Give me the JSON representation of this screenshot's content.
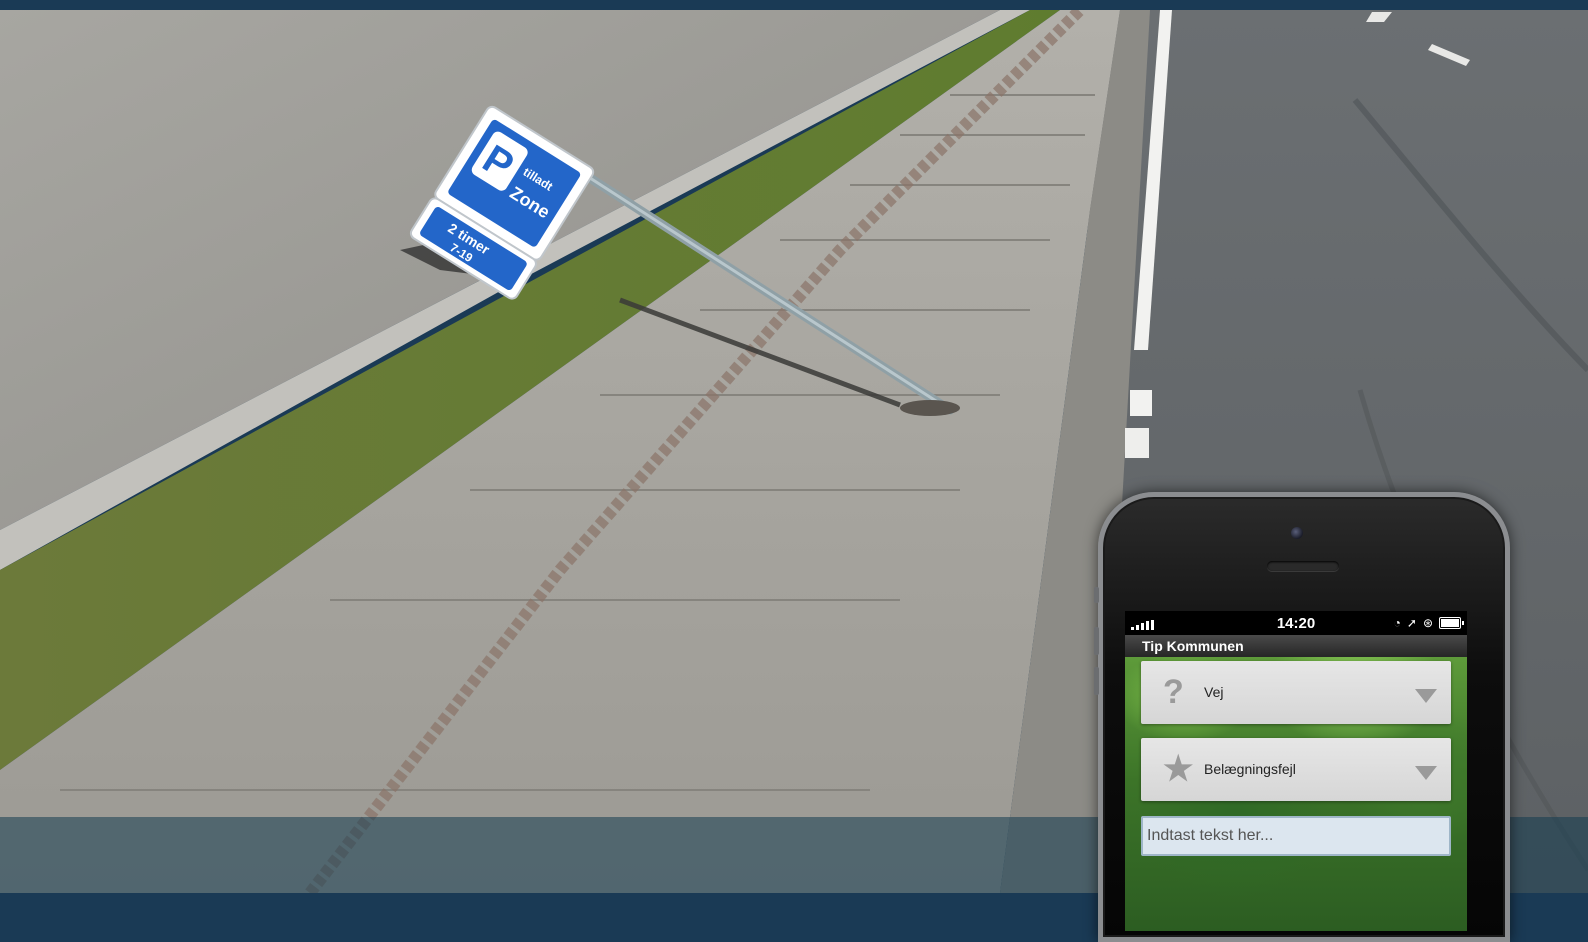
{
  "phone": {
    "status_bar": {
      "time": "14:20",
      "icons": [
        "signal-icon",
        "alarm-icon",
        "location-arrow-icon",
        "rotation-lock-icon",
        "battery-icon"
      ]
    },
    "app": {
      "title": "Tip Kommunen",
      "category_select": {
        "icon": "question-icon",
        "value": "Vej"
      },
      "subcategory_select": {
        "icon": "star-icon",
        "value": "Belægningsfejl"
      },
      "message_input": {
        "placeholder": "Indtast tekst her..."
      }
    }
  },
  "background_photo": {
    "sign_text": [
      "P",
      "tilladt",
      "Zone",
      "2 timer",
      "7-19"
    ]
  }
}
